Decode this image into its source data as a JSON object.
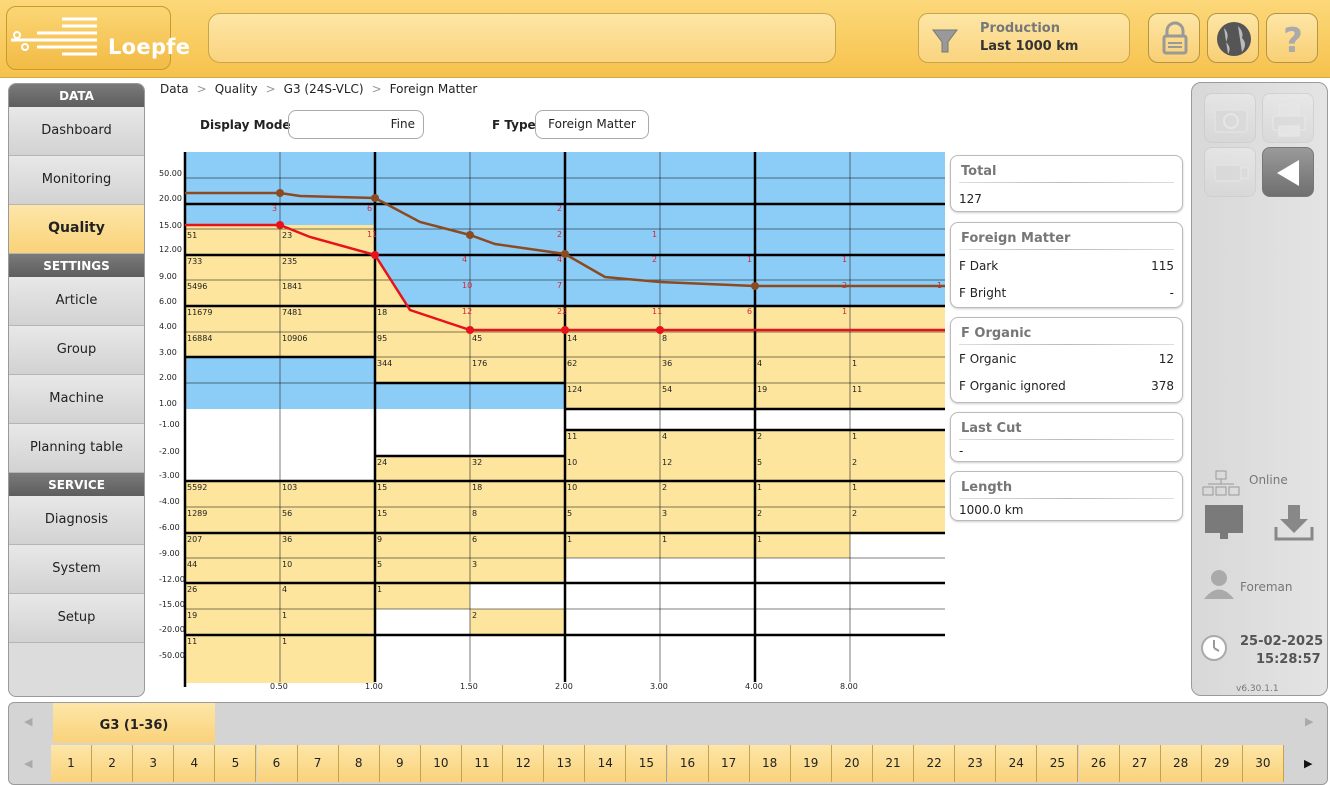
{
  "header": {
    "logo": "Loepfe",
    "filter": {
      "line1": "Production",
      "line2": "Last 1000 km"
    },
    "buttons": [
      "lock-icon",
      "globe-icon",
      "help-icon"
    ]
  },
  "nav": {
    "sections": [
      {
        "title": "DATA",
        "items": [
          "Dashboard",
          "Monitoring",
          "Quality"
        ]
      },
      {
        "title": "SETTINGS",
        "items": [
          "Article",
          "Group",
          "Machine",
          "Planning table"
        ]
      },
      {
        "title": "SERVICE",
        "items": [
          "Diagnosis",
          "System",
          "Setup"
        ]
      }
    ],
    "active": "Quality"
  },
  "breadcrumb": [
    "Data",
    "Quality",
    "G3 (24S-VLC)",
    "Foreign Matter"
  ],
  "controls": {
    "display_mode_label": "Display Mode",
    "display_mode_value": "Fine",
    "ftype_label": "F Type",
    "ftype_value": "Foreign Matter"
  },
  "chart_data": {
    "type": "table",
    "y_labels": [
      "50.00",
      "20.00",
      "15.00",
      "12.00",
      "9.00",
      "6.00",
      "4.00",
      "3.00",
      "2.00",
      "1.00",
      "-1.00",
      "-2.00",
      "-3.00",
      "-4.00",
      "-6.00",
      "-9.00",
      "-12.00",
      "-15.00",
      "-20.00",
      "-50.00"
    ],
    "x_labels": [
      "0.50",
      "1.00",
      "1.50",
      "2.00",
      "3.00",
      "4.00",
      "8.00"
    ],
    "cuts_cells": [
      [
        "3",
        "6",
        "",
        "2",
        "",
        "",
        "",
        ""
      ],
      [
        "",
        "11",
        "",
        "2",
        "1",
        "",
        "",
        ""
      ],
      [
        "",
        "",
        "4",
        "4",
        "2",
        "1",
        "1",
        ""
      ],
      [
        "",
        "",
        "10",
        "7",
        "",
        "",
        "2",
        "1"
      ],
      [
        "",
        "",
        "12",
        "22",
        "11",
        "6",
        "1",
        ""
      ]
    ],
    "dark_counts_top": [
      [
        "51",
        "23",
        "",
        "",
        "",
        "",
        "",
        ""
      ],
      [
        "733",
        "235",
        "",
        "",
        "",
        "",
        "",
        ""
      ],
      [
        "5496",
        "1841",
        "",
        "",
        "",
        "",
        "",
        ""
      ],
      [
        "11679",
        "7481",
        "18",
        "",
        "",
        "",
        "",
        ""
      ],
      [
        "16884",
        "10906",
        "95",
        "45",
        "14",
        "8",
        "",
        ""
      ],
      [
        "",
        "",
        "344",
        "176",
        "62",
        "36",
        "4",
        "1"
      ],
      [
        "",
        "",
        "",
        "",
        "124",
        "54",
        "19",
        "11"
      ]
    ],
    "dark_counts_bottom": [
      [
        "",
        "",
        "",
        "",
        "11",
        "4",
        "2",
        "1"
      ],
      [
        "",
        "",
        "24",
        "32",
        "10",
        "12",
        "5",
        "2"
      ],
      [
        "5592",
        "103",
        "15",
        "18",
        "10",
        "2",
        "1",
        "1"
      ],
      [
        "1289",
        "56",
        "15",
        "8",
        "5",
        "3",
        "2",
        "2"
      ],
      [
        "207",
        "36",
        "9",
        "6",
        "1",
        "1",
        "1",
        ""
      ],
      [
        "44",
        "10",
        "5",
        "3",
        "",
        "",
        "",
        ""
      ],
      [
        "26",
        "4",
        "1",
        "",
        "",
        "",
        "",
        ""
      ],
      [
        "19",
        "1",
        "",
        "2",
        "",
        "",
        "",
        ""
      ],
      [
        "11",
        "1",
        "",
        "",
        "",
        "",
        "",
        ""
      ]
    ],
    "red_curve_points": [
      [
        0,
        15.0
      ],
      [
        0.5,
        15.0
      ],
      [
        1.0,
        12.0
      ],
      [
        1.5,
        4.0
      ],
      [
        2.0,
        4.0
      ],
      [
        3.0,
        4.0
      ]
    ],
    "brown_curve_points": [
      [
        0,
        23.0
      ],
      [
        0.5,
        23.0
      ],
      [
        1.0,
        22.0
      ],
      [
        1.5,
        14.0
      ],
      [
        2.0,
        12.0
      ],
      [
        4.0,
        8.0
      ],
      [
        8.0,
        8.0
      ]
    ]
  },
  "panels": {
    "total": {
      "title": "Total",
      "value": "127"
    },
    "foreign": {
      "title": "Foreign Matter",
      "rows": [
        [
          "F Dark",
          "115"
        ],
        [
          "F Bright",
          "-"
        ]
      ]
    },
    "organic": {
      "title": "F Organic",
      "rows": [
        [
          "F Organic",
          "12"
        ],
        [
          "F Organic ignored",
          "378"
        ]
      ]
    },
    "lastcut": {
      "title": "Last Cut",
      "value": "-"
    },
    "length": {
      "title": "Length",
      "value": "1000.0 km"
    }
  },
  "status": {
    "connection": "Online",
    "user": "Foreman",
    "date": "25-02-2025",
    "time": "15:28:57",
    "version": "v6.30.1.1"
  },
  "bottom": {
    "group_tab": "G3 (1-36)",
    "spindles": [
      "1",
      "2",
      "3",
      "4",
      "5",
      "6",
      "7",
      "8",
      "9",
      "10",
      "11",
      "12",
      "13",
      "14",
      "15",
      "16",
      "17",
      "18",
      "19",
      "20",
      "21",
      "22",
      "23",
      "24",
      "25",
      "26",
      "27",
      "28",
      "29",
      "30"
    ]
  },
  "colors": {
    "accent": "#f8c94f",
    "active": "#fad27a",
    "sky": "#8ccdf8",
    "cell": "#fde59d",
    "red": "#e8121a",
    "brown": "#8b4a20"
  }
}
